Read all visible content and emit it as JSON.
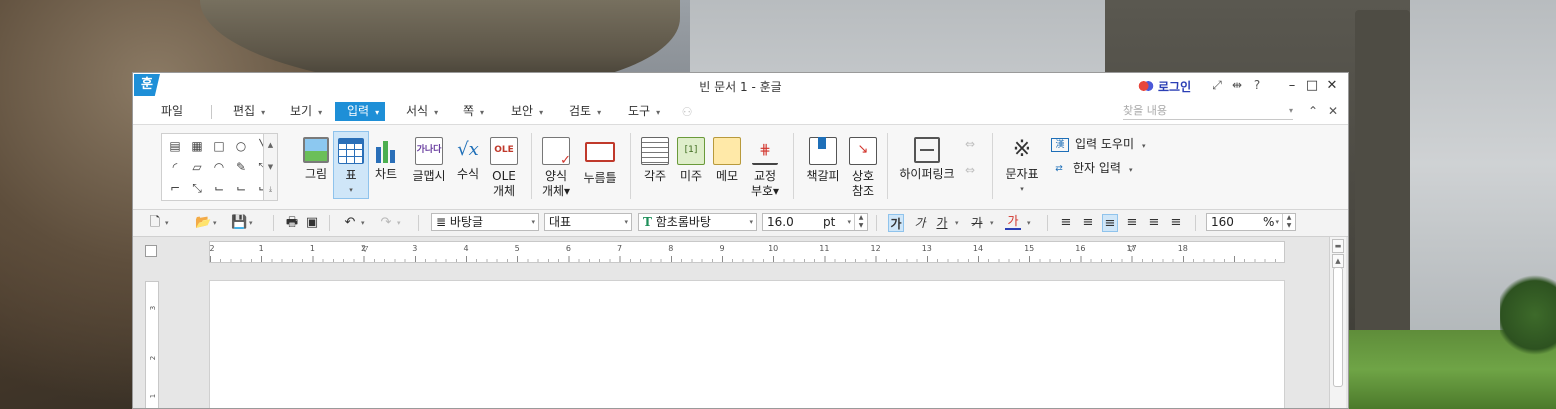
{
  "window": {
    "app_icon_glyph": "훈",
    "title": "빈 문서 1 - 훈글",
    "login_label": "로그인"
  },
  "titlebar_icons": [
    "fullscreen-icon",
    "split-icon",
    "help-icon",
    "minimize-icon",
    "maximize-icon",
    "close-icon"
  ],
  "titlebar_glyphs": {
    "fullscreen": "⤢",
    "split": "⇹",
    "help": "?",
    "minimize": "–",
    "maximize": "□",
    "close": "✕"
  },
  "menu": {
    "items": [
      {
        "label": "파일"
      },
      {
        "label": "편집"
      },
      {
        "label": "보기"
      },
      {
        "label": "입력",
        "active": true
      },
      {
        "label": "서식"
      },
      {
        "label": "쪽"
      },
      {
        "label": "보안"
      },
      {
        "label": "검토"
      },
      {
        "label": "도구"
      }
    ],
    "search_placeholder": "찾을 내용"
  },
  "ribbon": {
    "shape_glyphs": [
      "▤",
      "▦",
      "□",
      "○",
      "╲",
      "◜",
      "▱",
      "◠",
      "✎",
      "⤡",
      "⌐",
      "⤡",
      "⌙",
      "⌙",
      "⌙"
    ],
    "gallery_scroll": [
      "▲",
      "▼",
      "⤓"
    ],
    "groups": [
      {
        "label": "그림"
      },
      {
        "label": "표",
        "sublabel": "▾",
        "selected": true
      },
      {
        "label": "차트"
      },
      {
        "label": "글맵시"
      },
      {
        "label": "수식"
      },
      {
        "label": "OLE",
        "sublabel": "개체"
      },
      {
        "label": "양식",
        "sublabel": "개체▾"
      },
      {
        "label": "누름틀"
      },
      {
        "label": "각주"
      },
      {
        "label": "미주"
      },
      {
        "label": "메모"
      },
      {
        "label": "교정",
        "sublabel": "부호▾"
      },
      {
        "label": "책갈피"
      },
      {
        "label": "상호",
        "sublabel": "참조"
      },
      {
        "label": "하이퍼링크"
      },
      {
        "label": "문자표",
        "sublabel": "▾"
      }
    ],
    "icon_text": {
      "wordart": "가나다",
      "formula": "√x",
      "ole": "OLE",
      "endnote": "[1]",
      "proof": "⋕",
      "chars": "※"
    },
    "small_cmds": [
      {
        "label": "입력 도우미",
        "icon": "漢"
      },
      {
        "label": "한자 입력",
        "icon": "⇄"
      }
    ]
  },
  "format_bar": {
    "style": "바탕글",
    "language": "대표",
    "font": "함초롬바탕",
    "font_icon": "T",
    "size": "16.0",
    "size_unit": "pt",
    "bold": "가",
    "italic": "가",
    "underline": "가",
    "strike": "가",
    "fontcolor": "가",
    "zoom": "160",
    "zoom_unit": "%",
    "glyphs": {
      "new": "🗋",
      "open": "📂",
      "save": "💾",
      "print": "🖶",
      "preview": "▣",
      "undo": "↶",
      "redo": "↷",
      "style_icon": "≣"
    },
    "align_glyphs": [
      "≡",
      "≡",
      "≡",
      "≡",
      "≡",
      "≡"
    ]
  },
  "ruler": {
    "labels": [
      "2",
      "1",
      "1",
      "2",
      "3",
      "4",
      "5",
      "6",
      "7",
      "8",
      "9",
      "10",
      "11",
      "12",
      "13",
      "14",
      "15",
      "16",
      "17",
      "18"
    ],
    "vertical_labels": [
      "3",
      "2",
      "1"
    ],
    "corner_glyph": "└"
  }
}
